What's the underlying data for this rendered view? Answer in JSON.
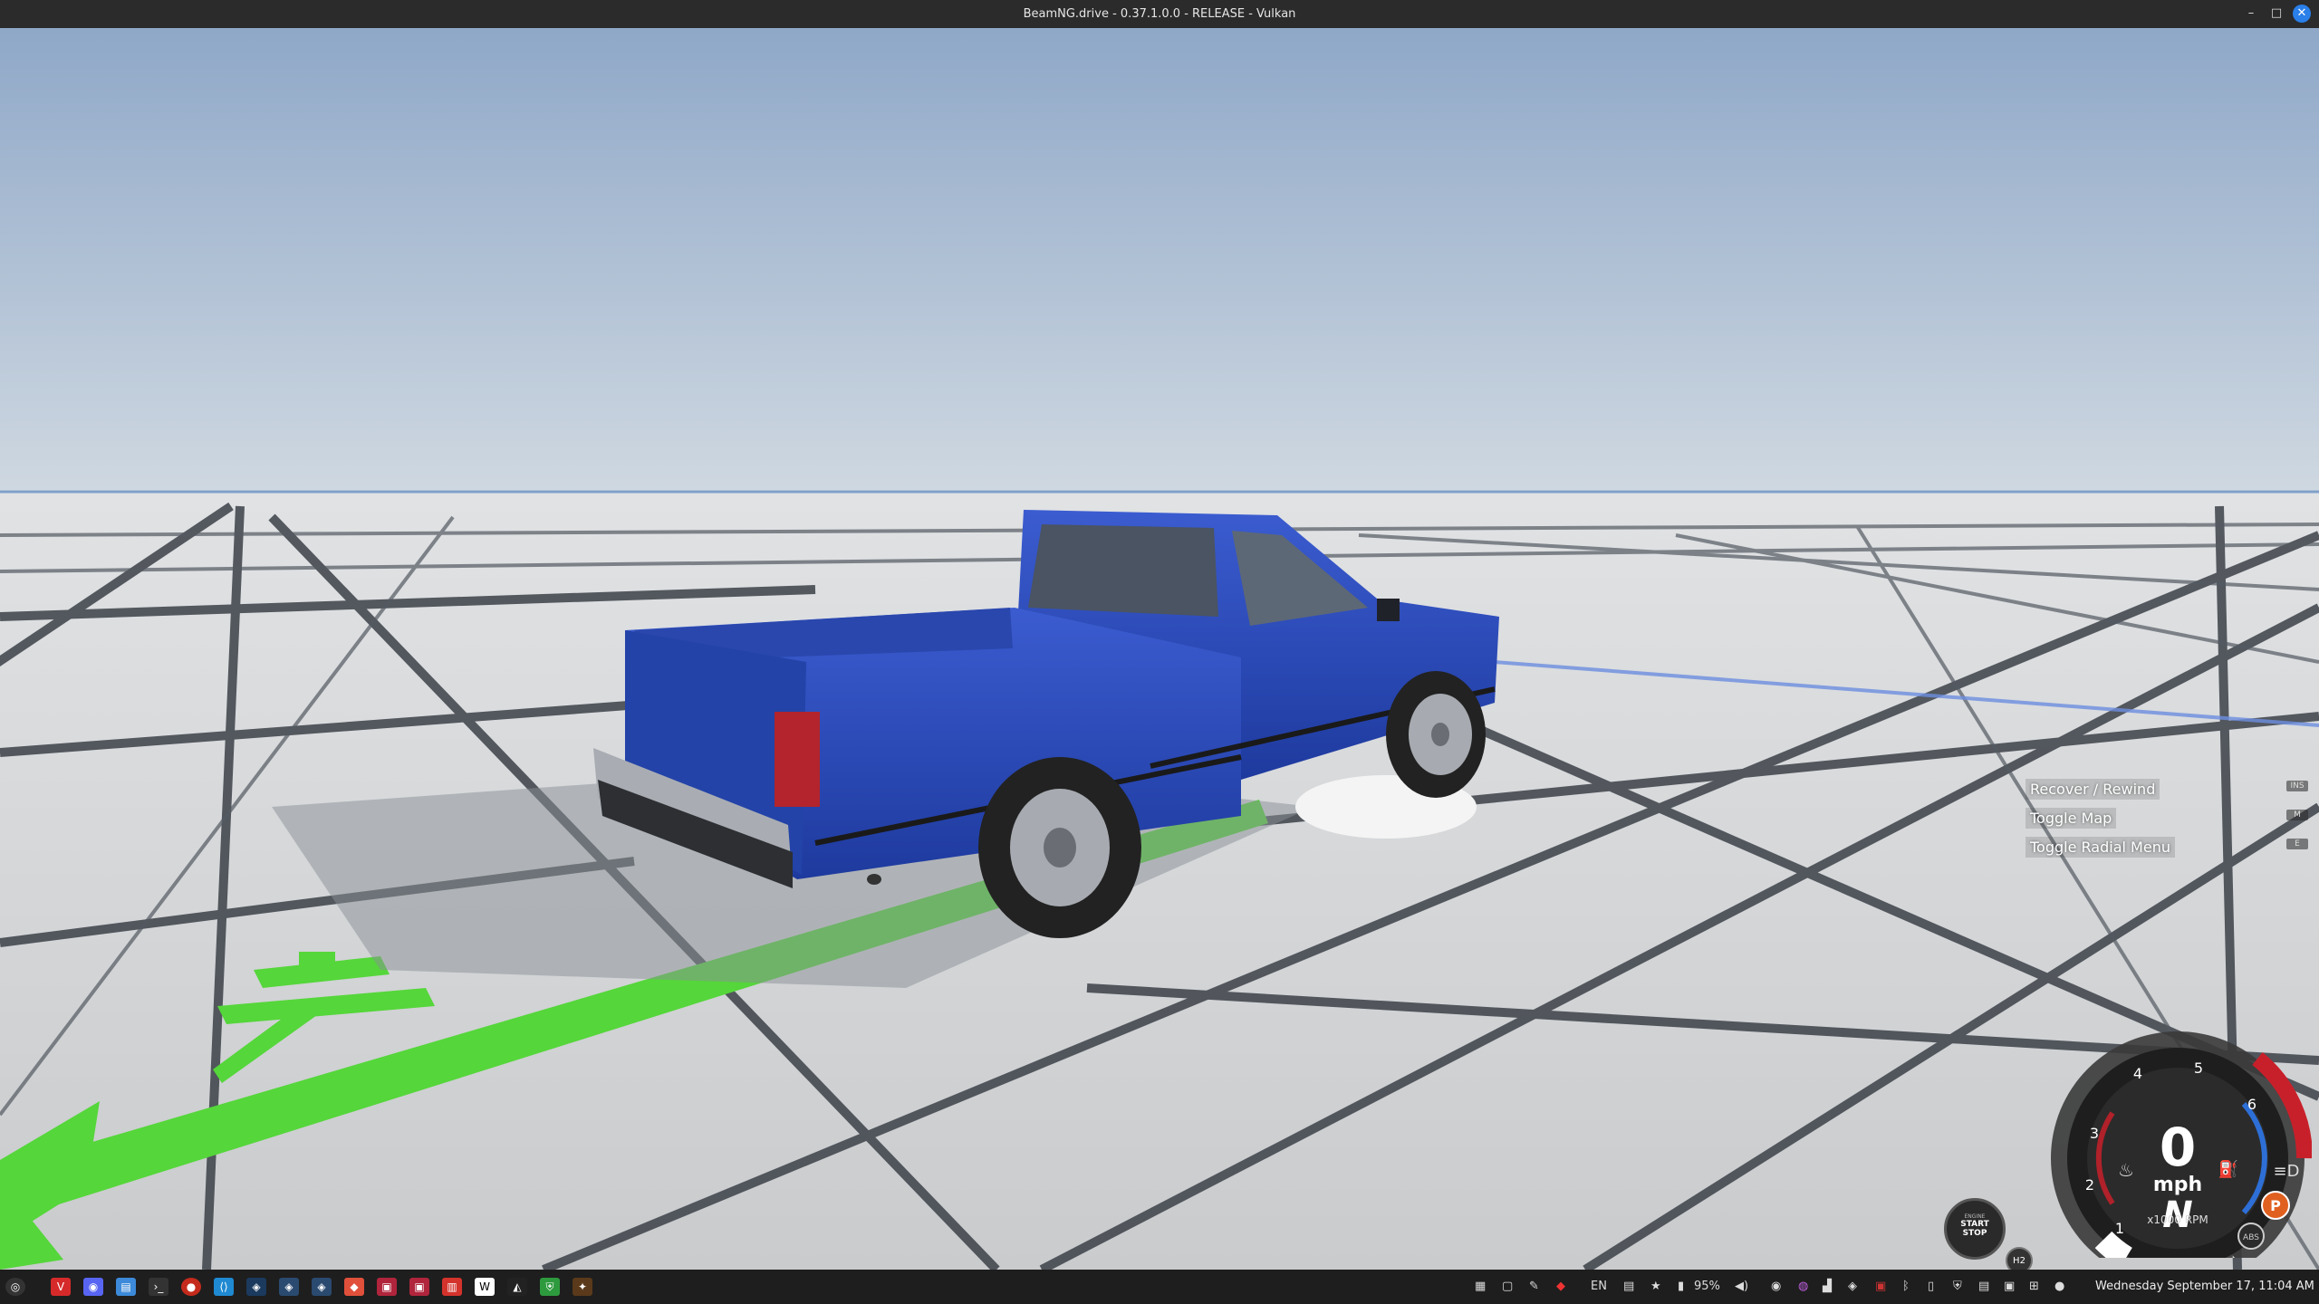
{
  "window": {
    "title": "BeamNG.drive - 0.37.1.0.0 - RELEASE - Vulkan",
    "minimize_glyph": "–",
    "maximize_glyph": "□",
    "close_glyph": "✕"
  },
  "hints": [
    {
      "label": "Recover / Rewind",
      "key": "INS"
    },
    {
      "label": "Toggle Map",
      "key": "M"
    },
    {
      "label": "Toggle Radial Menu",
      "key": "E"
    }
  ],
  "engine_button": {
    "line1": "ENGINE",
    "line2": "START",
    "line3": "STOP"
  },
  "h2_badge": "H2",
  "dashboard": {
    "speed": "0",
    "speed_unit": "mph",
    "gear": "N",
    "rpm_label": "x1000 RPM",
    "rpm_ticks": [
      "1",
      "2",
      "3",
      "4",
      "5",
      "6"
    ],
    "rpm_value": 0.7,
    "abs_label": "ABS",
    "parking_label": "P"
  },
  "taskbar": {
    "language": "EN",
    "battery": "95%",
    "clock": "Wednesday September 17, 11:04 AM"
  },
  "colors": {
    "sky_top": "#8fa8c8",
    "sky_horizon": "#c9d4df",
    "ground": "#d2d4d6",
    "grid_line": "#3c4148",
    "truck_blue": "#2a49b8",
    "green_marker": "#55d63a",
    "gauge_red": "#c8202a",
    "gauge_blue": "#2d6fd6"
  }
}
